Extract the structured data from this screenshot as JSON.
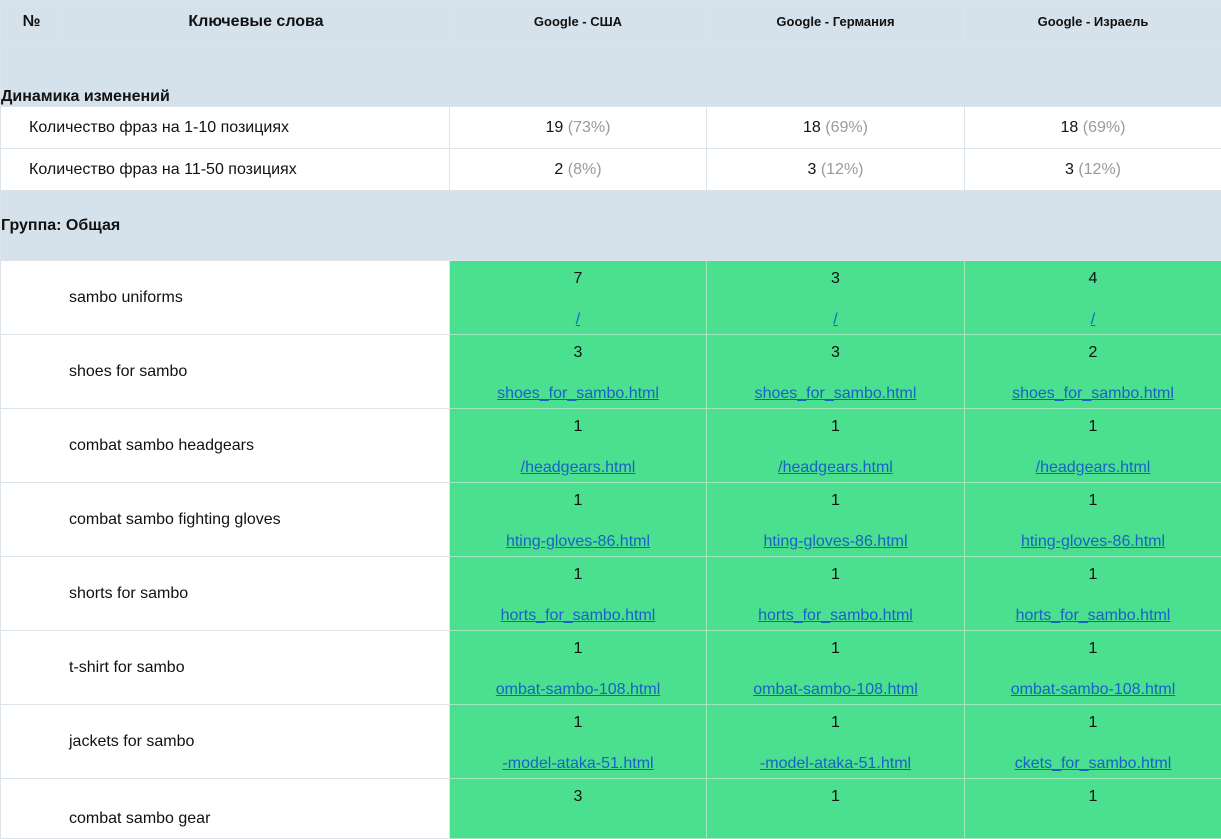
{
  "header": {
    "num_label": "№",
    "keywords_label": "Ключевые слова",
    "engines": [
      "Google - США",
      "Google - Германия",
      "Google - Израель"
    ]
  },
  "dynamics": {
    "title": "Динамика изменений",
    "rows": [
      {
        "label": "Количество фраз на 1-10 позициях",
        "values": [
          {
            "count": "19",
            "pct": "(73%)"
          },
          {
            "count": "18",
            "pct": "(69%)"
          },
          {
            "count": "18",
            "pct": "(69%)"
          }
        ]
      },
      {
        "label": "Количество фраз на 11-50 позициях",
        "values": [
          {
            "count": "2",
            "pct": "(8%)"
          },
          {
            "count": "3",
            "pct": "(12%)"
          },
          {
            "count": "3",
            "pct": "(12%)"
          }
        ]
      }
    ]
  },
  "group": {
    "title": "Группа:  Общая",
    "cell_color": "#4ae090",
    "keywords": [
      {
        "name": "sambo uniforms",
        "positions": [
          {
            "pos": "7",
            "url": "/"
          },
          {
            "pos": "3",
            "url": "/"
          },
          {
            "pos": "4",
            "url": "/"
          }
        ]
      },
      {
        "name": "shoes for sambo",
        "positions": [
          {
            "pos": "3",
            "url": "shoes_for_sambo.html"
          },
          {
            "pos": "3",
            "url": "shoes_for_sambo.html"
          },
          {
            "pos": "2",
            "url": "shoes_for_sambo.html"
          }
        ]
      },
      {
        "name": "combat sambo headgears",
        "positions": [
          {
            "pos": "1",
            "url": "/headgears.html"
          },
          {
            "pos": "1",
            "url": "/headgears.html"
          },
          {
            "pos": "1",
            "url": "/headgears.html"
          }
        ]
      },
      {
        "name": "combat sambo fighting gloves",
        "positions": [
          {
            "pos": "1",
            "url": "hting-gloves-86.html"
          },
          {
            "pos": "1",
            "url": "hting-gloves-86.html"
          },
          {
            "pos": "1",
            "url": "hting-gloves-86.html"
          }
        ]
      },
      {
        "name": "shorts for sambo",
        "positions": [
          {
            "pos": "1",
            "url": "horts_for_sambo.html"
          },
          {
            "pos": "1",
            "url": "horts_for_sambo.html"
          },
          {
            "pos": "1",
            "url": "horts_for_sambo.html"
          }
        ]
      },
      {
        "name": "t-shirt for sambo",
        "positions": [
          {
            "pos": "1",
            "url": "ombat-sambo-108.html"
          },
          {
            "pos": "1",
            "url": "ombat-sambo-108.html"
          },
          {
            "pos": "1",
            "url": "ombat-sambo-108.html"
          }
        ]
      },
      {
        "name": "jackets for sambo",
        "positions": [
          {
            "pos": "1",
            "url": "-model-ataka-51.html"
          },
          {
            "pos": "1",
            "url": "-model-ataka-51.html"
          },
          {
            "pos": "1",
            "url": "ckets_for_sambo.html"
          }
        ]
      },
      {
        "name": "combat sambo gear",
        "positions": [
          {
            "pos": "3",
            "url": ""
          },
          {
            "pos": "1",
            "url": ""
          },
          {
            "pos": "1",
            "url": ""
          }
        ]
      }
    ]
  }
}
